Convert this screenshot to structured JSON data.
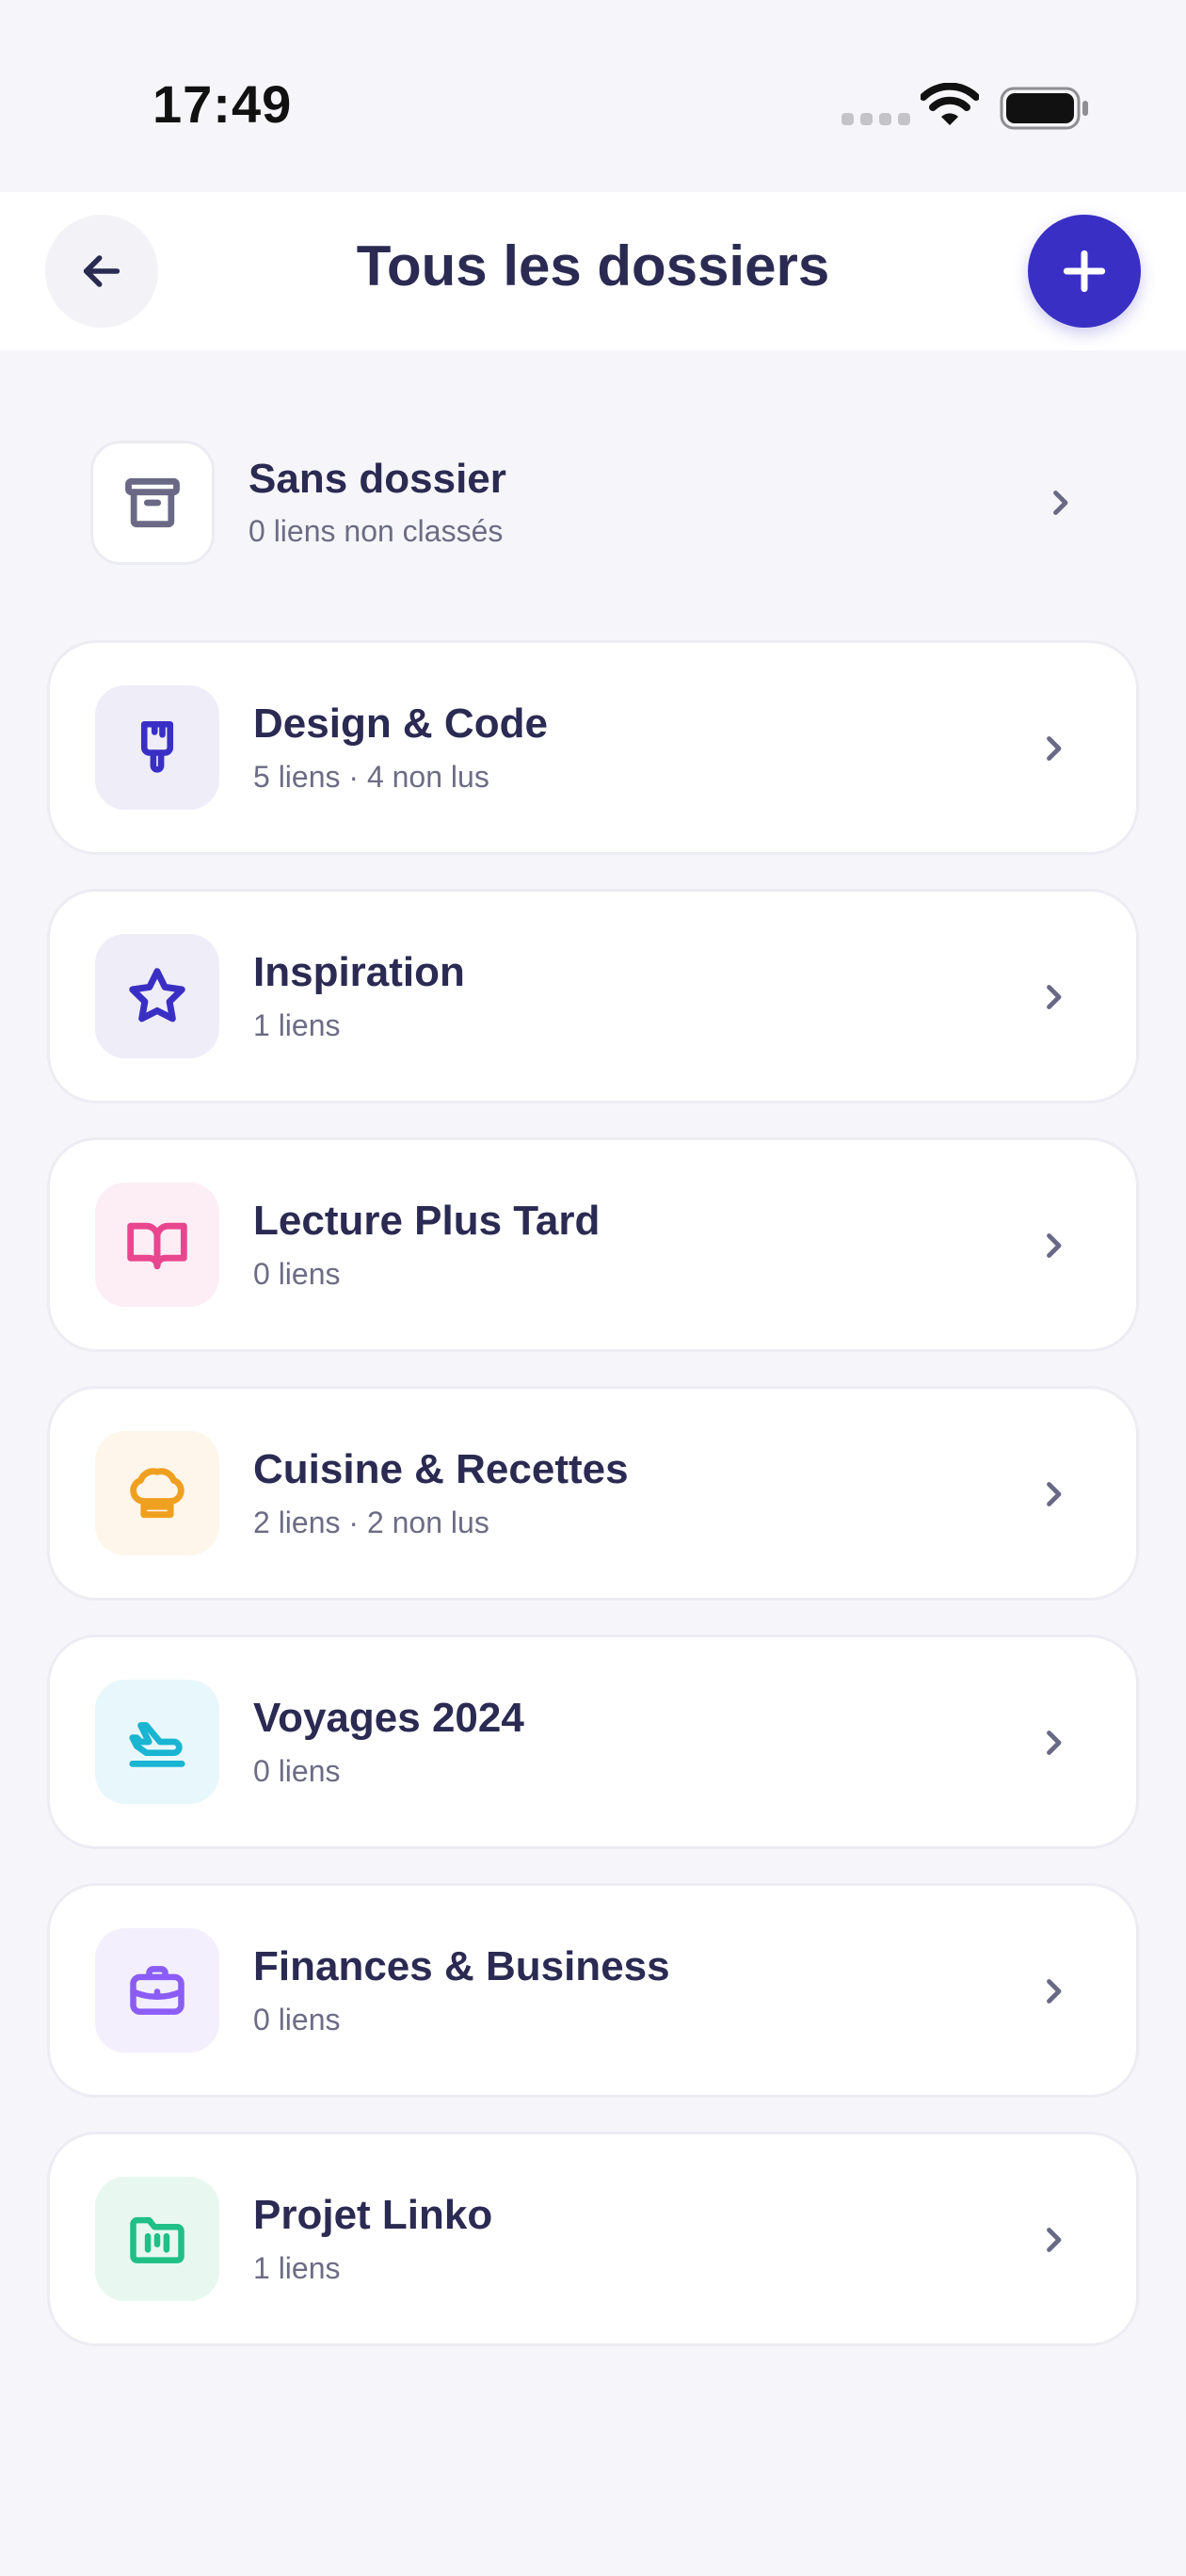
{
  "status_bar": {
    "time": "17:49"
  },
  "header": {
    "title": "Tous les dossiers"
  },
  "unsorted": {
    "title": "Sans dossier",
    "subtitle": "0 liens non classés",
    "icon": "archive-icon"
  },
  "folders": [
    {
      "name": "Design & Code",
      "meta": "5 liens · 4 non lus",
      "icon": "paintbrush-icon",
      "color": "#3a2fc4",
      "bg": "#eeedf8"
    },
    {
      "name": "Inspiration",
      "meta": "1 liens",
      "icon": "star-icon",
      "color": "#3a2fc4",
      "bg": "#eeedf8"
    },
    {
      "name": "Lecture Plus Tard",
      "meta": "0 liens",
      "icon": "book-open-icon",
      "color": "#e8468f",
      "bg": "#fdeef5"
    },
    {
      "name": "Cuisine & Recettes",
      "meta": "2 liens · 2 non lus",
      "icon": "chef-hat-icon",
      "color": "#f0a020",
      "bg": "#fef6ea"
    },
    {
      "name": "Voyages 2024",
      "meta": "0 liens",
      "icon": "plane-icon",
      "color": "#19b5d2",
      "bg": "#e8f7fb"
    },
    {
      "name": "Finances & Business",
      "meta": "0 liens",
      "icon": "briefcase-icon",
      "color": "#8b5cf6",
      "bg": "#f3effd"
    },
    {
      "name": "Projet Linko",
      "meta": "1 liens",
      "icon": "folder-kanban-icon",
      "color": "#1fbf86",
      "bg": "#e8f8f1"
    }
  ]
}
